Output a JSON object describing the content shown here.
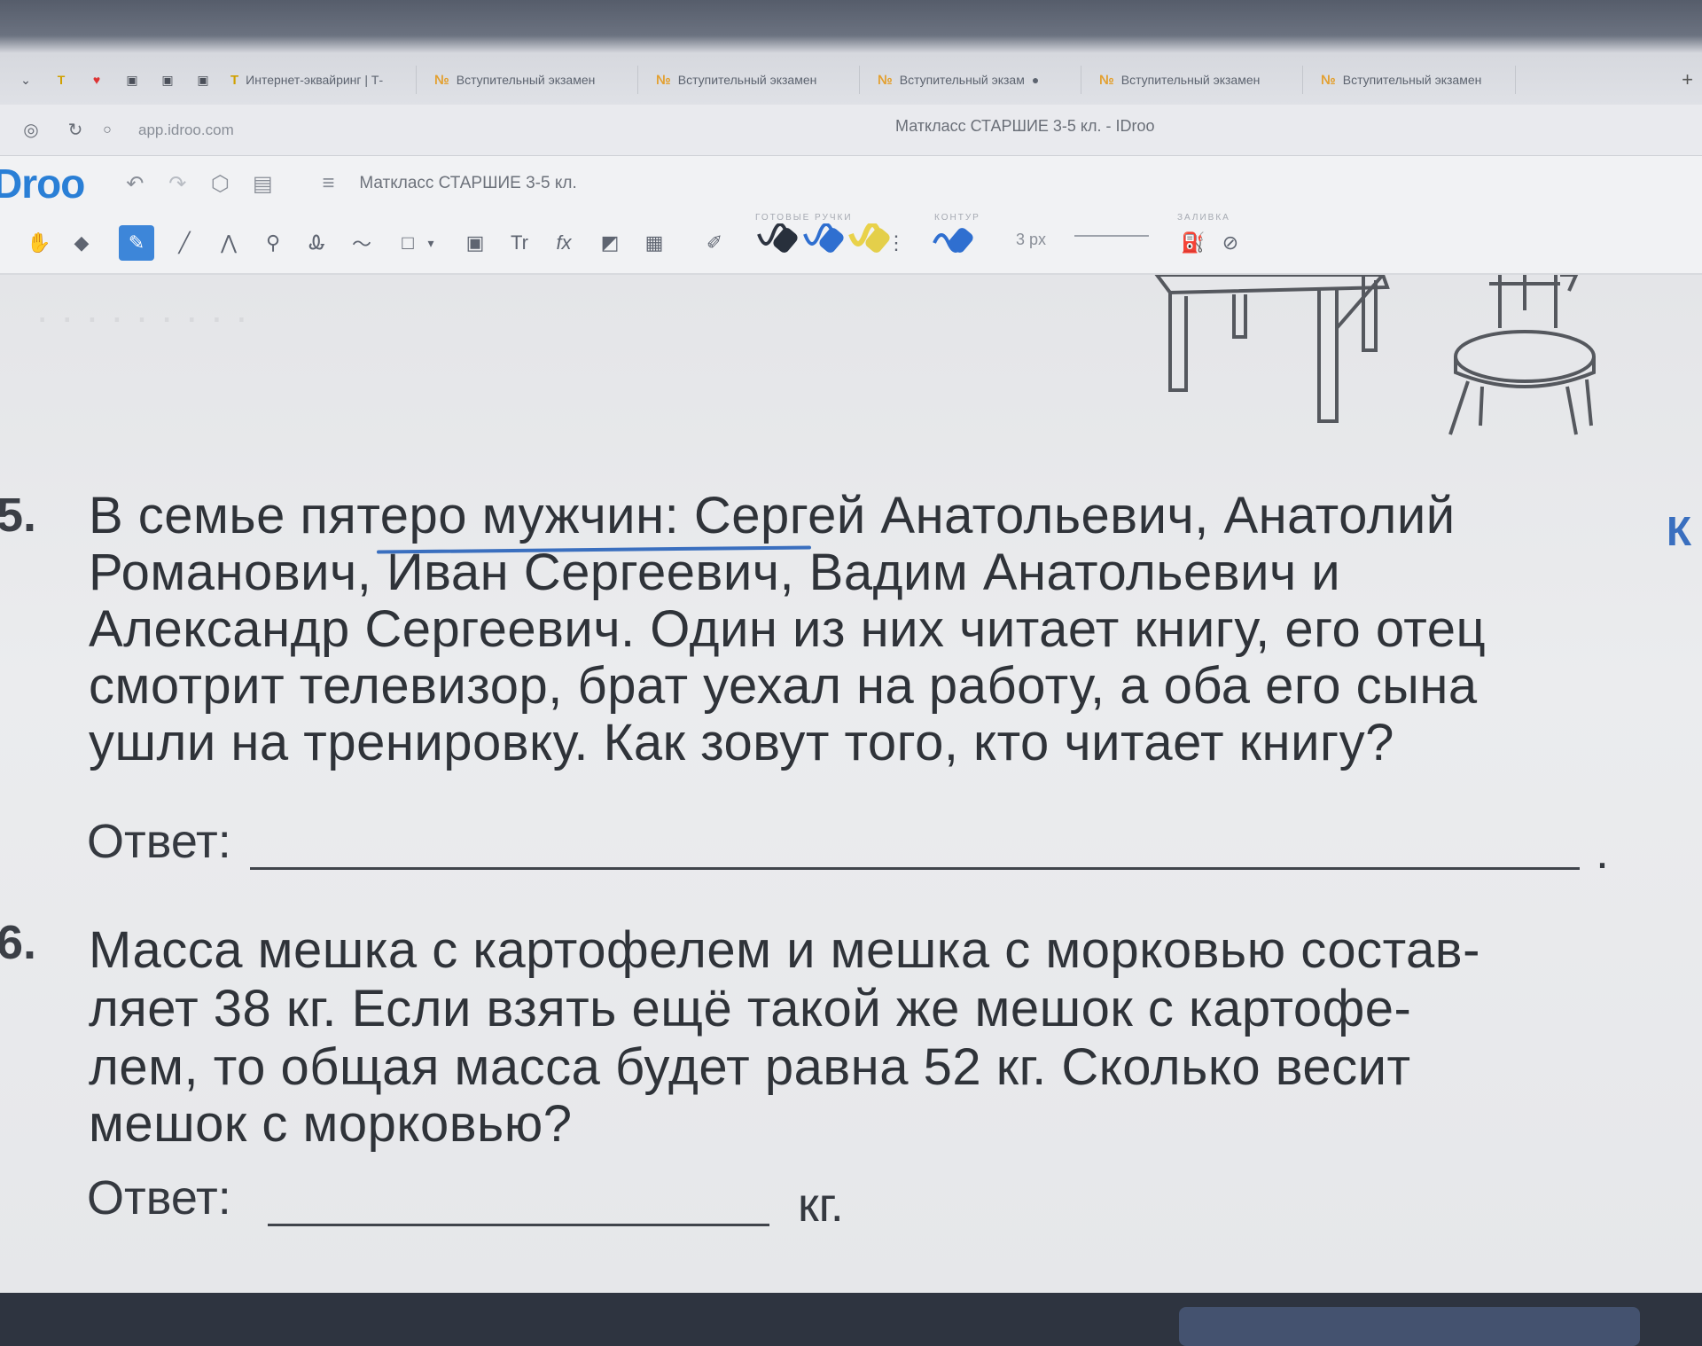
{
  "browser": {
    "tabs": [
      {
        "label": "Интернет-эквайринг | Т-"
      },
      {
        "label": "Вступительный экзамен"
      },
      {
        "label": "Вступительный экзамен"
      },
      {
        "label": "Вступительный экзам"
      },
      {
        "label": "Вступительный экзамен"
      },
      {
        "label": "Вступительный экзамен"
      }
    ],
    "url": "app.idroo.com",
    "page_title": "Матклacc СТАРШИЕ 3-5 кл. - IDroo"
  },
  "app": {
    "logo": "Droo",
    "board_name": "Матклacc СТАРШИЕ 3-5 кл."
  },
  "toolbar": {
    "group_pens": "ГОТОВЫЕ РУЧКИ",
    "group_contour": "КОНТУР",
    "group_fill": "ЗАЛИВКА",
    "stroke_size": "3 px",
    "text_tool": "Tr",
    "formula_tool": "fx"
  },
  "page": {
    "q5": {
      "number": "5.",
      "lines": [
        "В семье пятеро мужчин: Сергей Анатольевич, Анатолий",
        "Романович, Иван Сергеевич, Вадим Анатольевич и",
        "Александр Сергеевич. Один из них читает книгу, его отец",
        "смотрит телевизор, брат уехал на работу, а оба его сына",
        "ушли на тренировку. Как зовут того, кто читает книгу?"
      ],
      "answer_label": "Ответ:",
      "answer_end": ".",
      "margin_mark": "К"
    },
    "q6": {
      "number": "6.",
      "lines": [
        "Масса мешка с картофелем и мешка с морковью состав-",
        "ляет 38 кг. Если взять ещё такой же мешок с картофе-",
        "лем, то общая масса будет равна 52 кг. Сколько весит",
        "мешок с морковью?"
      ],
      "answer_label": "Ответ:",
      "answer_unit": "кг."
    }
  }
}
